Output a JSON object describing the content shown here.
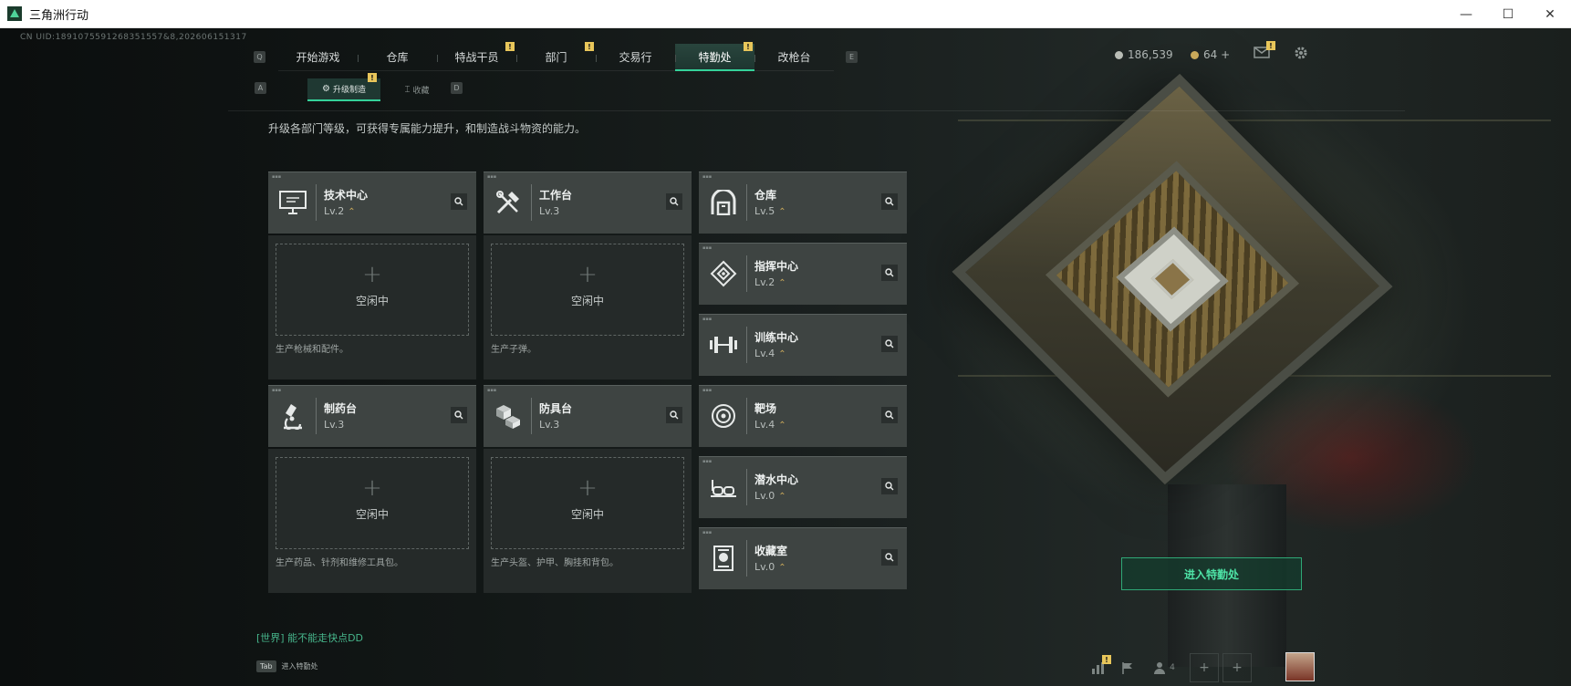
{
  "window": {
    "title": "三角洲行动",
    "minimize": "—",
    "maximize": "☐",
    "close": "✕"
  },
  "uid": "CN UID:1891075591268351557&8,202606151317",
  "tabs": {
    "left_key": "Q",
    "right_key": "E",
    "items": [
      {
        "label": "开始游戏"
      },
      {
        "label": "仓库"
      },
      {
        "label": "特战干员"
      },
      {
        "label": "部门"
      },
      {
        "label": "交易行"
      },
      {
        "label": "特勤处"
      },
      {
        "label": "改枪台"
      }
    ],
    "active": "特勤处"
  },
  "subtabs": {
    "left_key": "A",
    "right_key": "D",
    "items": [
      {
        "label": "升级制造",
        "icon": "⚙"
      },
      {
        "label": "收藏",
        "icon": "⌶"
      }
    ]
  },
  "currency": {
    "coins": "186,539",
    "tickets": "64 +"
  },
  "description": "升级各部门等级，可获得专属能力提升，和制造战斗物资的能力。",
  "facilities": {
    "tech_center": {
      "name": "技术中心",
      "level": "Lv.2",
      "icon": "monitor-icon"
    },
    "workbench": {
      "name": "工作台",
      "level": "Lv.3",
      "icon": "tools-icon"
    },
    "pharmacy": {
      "name": "制药台",
      "level": "Lv.3",
      "icon": "microscope-icon"
    },
    "armor_bench": {
      "name": "防具台",
      "level": "Lv.3",
      "icon": "blocks-icon"
    },
    "warehouse": {
      "name": "仓库",
      "level": "Lv.5",
      "icon": "warehouse-icon"
    },
    "command_center": {
      "name": "指挥中心",
      "level": "Lv.2",
      "icon": "diamond-icon"
    },
    "training_center": {
      "name": "训练中心",
      "level": "Lv.4",
      "icon": "dumbbell-icon"
    },
    "range": {
      "name": "靶场",
      "level": "Lv.4",
      "icon": "target-icon"
    },
    "diving_center": {
      "name": "潜水中心",
      "level": "Lv.0",
      "icon": "goggles-icon"
    },
    "collection_room": {
      "name": "收藏室",
      "level": "Lv.0",
      "icon": "cabinet-icon"
    }
  },
  "slots": {
    "idle_label": "空闲中",
    "tech_center_note": "生产枪械和配件。",
    "workbench_note": "生产子弹。",
    "pharmacy_note": "生产药品、针剂和维修工具包。",
    "armor_bench_note": "生产头盔、护甲、胸挂和背包。"
  },
  "enter_button": "进入特勤处",
  "chat": "[世界] 能不能走快点DD",
  "tab_hint": {
    "key": "Tab",
    "label": "进入特勤处"
  },
  "bottom": {
    "friends_count": "4"
  },
  "colors": {
    "accent": "#35d29a",
    "badge": "#e8c65a"
  }
}
